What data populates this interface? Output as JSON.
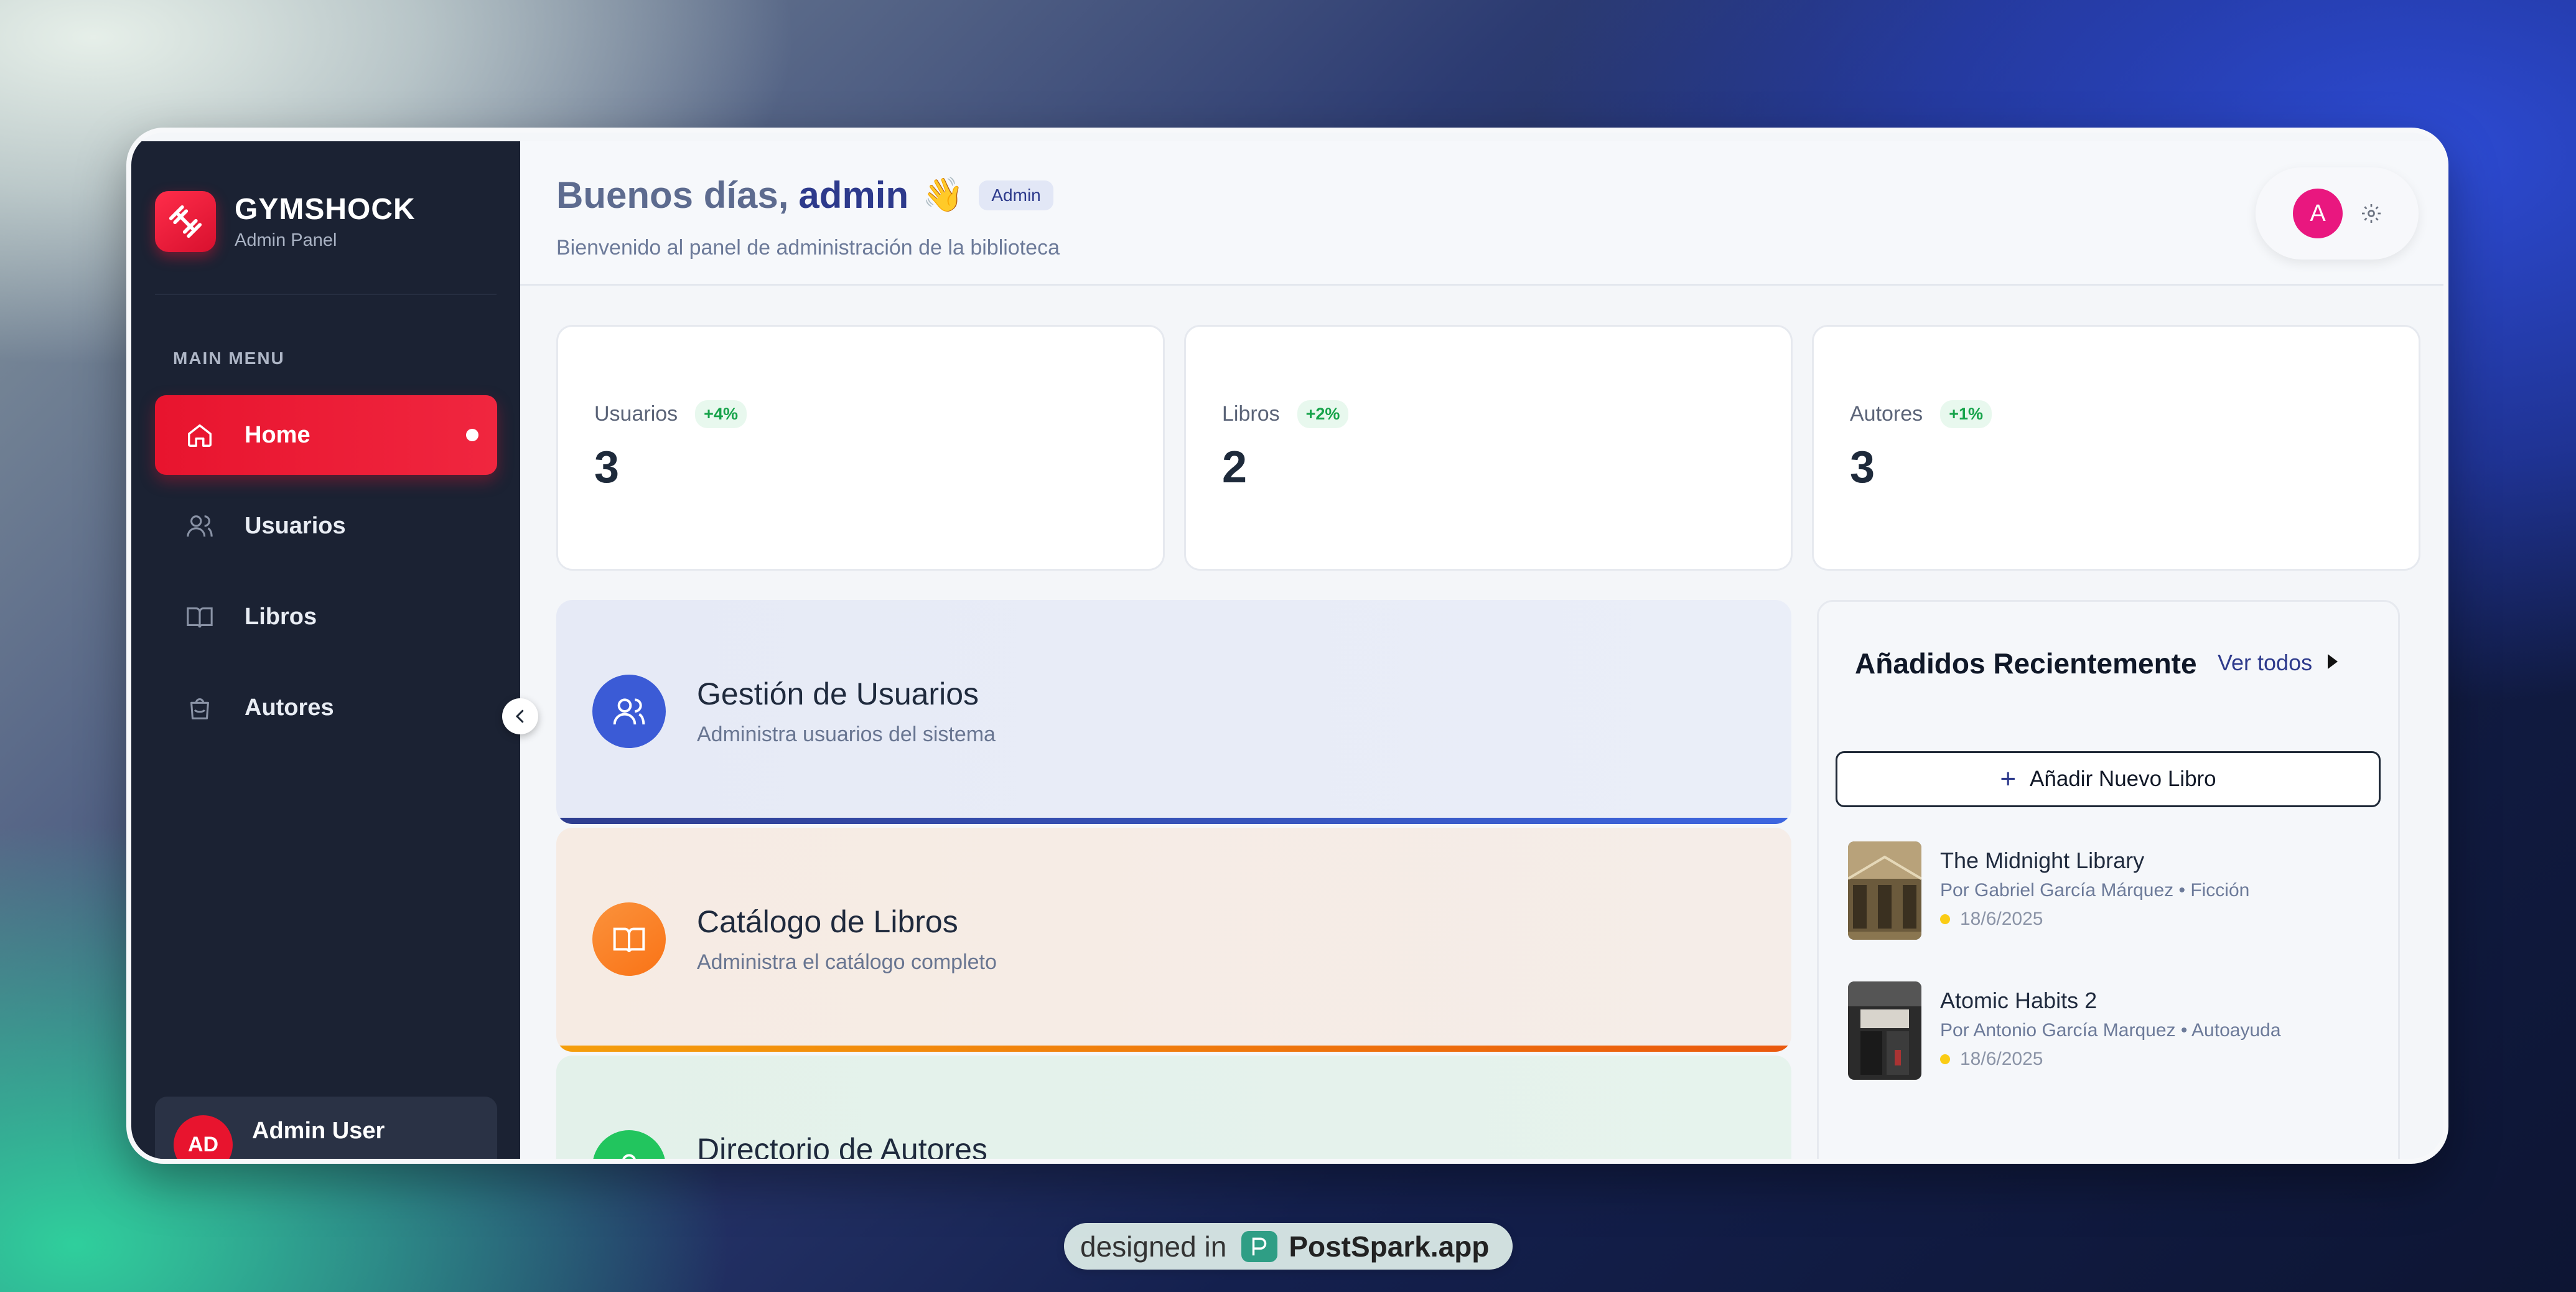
{
  "brand": {
    "name": "GYMSHOCK",
    "subtitle": "Admin Panel"
  },
  "sidebar": {
    "menu_title": "MAIN MENU",
    "items": [
      {
        "label": "Home",
        "icon": "home-icon",
        "active": true
      },
      {
        "label": "Usuarios",
        "icon": "users-icon",
        "active": false
      },
      {
        "label": "Libros",
        "icon": "book-open-icon",
        "active": false
      },
      {
        "label": "Autores",
        "icon": "bag-icon",
        "active": false
      }
    ],
    "user": {
      "initials": "AD",
      "name": "Admin User"
    }
  },
  "header": {
    "greeting": "Buenos días,",
    "name": "admin",
    "emoji": "👋",
    "role": "Admin",
    "subtitle": "Bienvenido al panel de administración de la biblioteca",
    "avatar_letter": "A"
  },
  "stats": [
    {
      "label": "Usuarios",
      "delta": "+4%",
      "value": "3"
    },
    {
      "label": "Libros",
      "delta": "+2%",
      "value": "2"
    },
    {
      "label": "Autores",
      "delta": "+1%",
      "value": "3"
    }
  ],
  "modules": [
    {
      "title": "Gestión de Usuarios",
      "subtitle": "Administra usuarios del sistema",
      "icon": "users-icon",
      "color": "#3b5bd6"
    },
    {
      "title": "Catálogo de Libros",
      "subtitle": "Administra el catálogo completo",
      "icon": "book-open-icon",
      "color": "#f97316"
    },
    {
      "title": "Directorio de Autores",
      "subtitle": "",
      "icon": "user-icon",
      "color": "#22c55e"
    }
  ],
  "recent": {
    "title": "Añadidos Recientemente",
    "view_all": "Ver todos",
    "add_button": "Añadir Nuevo Libro",
    "books": [
      {
        "title": "The Midnight Library",
        "meta": "Por Gabriel García Márquez • Ficción",
        "date": "18/6/2025"
      },
      {
        "title": "Atomic Habits 2",
        "meta": "Por Antonio García Marquez • Autoayuda",
        "date": "18/6/2025"
      }
    ]
  },
  "footer_badge": {
    "prefix": "designed in",
    "name": "PostSpark.app"
  }
}
